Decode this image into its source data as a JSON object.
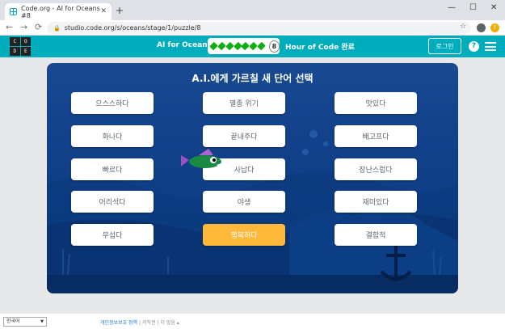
{
  "browser": {
    "tab_title": "Code.org - AI for Oceans #8",
    "tab_close": "✕",
    "new_tab": "+",
    "url": "studio.code.org/s/oceans/stage/1/puzzle/8",
    "window_controls": [
      "—",
      "☐",
      "✕"
    ],
    "nav": [
      "←",
      "→",
      "⟳"
    ],
    "star": "☆",
    "update_badge": "!"
  },
  "header": {
    "logo_letters": [
      "C",
      "O",
      "D",
      "E"
    ],
    "course_title": "AI for Oceans",
    "progress_completed": 7,
    "current_level": "8",
    "hoc_label": "Hour of Code 완료",
    "login_label": "로그인",
    "help_label": "?"
  },
  "game": {
    "prompt": "A.I.에게 가르칠 새 단어 선택",
    "words": [
      {
        "label": "으스스하다",
        "selected": false
      },
      {
        "label": "멸종 위기",
        "selected": false
      },
      {
        "label": "맛있다",
        "selected": false
      },
      {
        "label": "화나다",
        "selected": false
      },
      {
        "label": "끝내주다",
        "selected": false
      },
      {
        "label": "배고프다",
        "selected": false
      },
      {
        "label": "빠르다",
        "selected": false
      },
      {
        "label": "사납다",
        "selected": false
      },
      {
        "label": "장난스럽다",
        "selected": false
      },
      {
        "label": "어리석다",
        "selected": false
      },
      {
        "label": "야생",
        "selected": false
      },
      {
        "label": "재미있다",
        "selected": false
      },
      {
        "label": "무섭다",
        "selected": false
      },
      {
        "label": "행복하다",
        "selected": true
      },
      {
        "label": "결함적",
        "selected": false
      }
    ]
  },
  "footer": {
    "language": "한국어",
    "language_caret": "▼",
    "privacy": "개인정보보호 정책",
    "separator": "|",
    "copyright": "저작권",
    "more": "더 많음 ▴"
  },
  "colors": {
    "teal": "#00adbc",
    "selected": "#ffb83a",
    "progress_green": "#0eaf12"
  }
}
